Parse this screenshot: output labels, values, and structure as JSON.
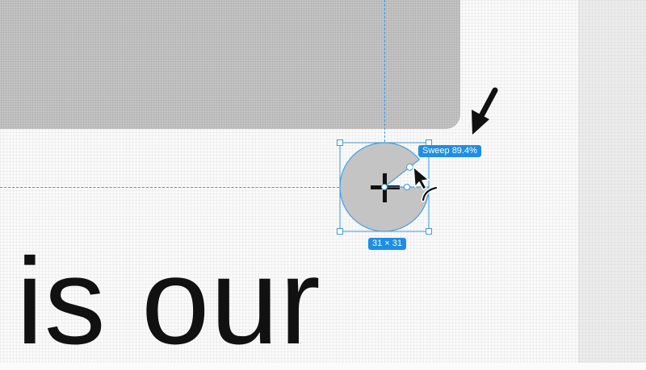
{
  "canvas": {
    "text": "is our"
  },
  "selection": {
    "sweep_label": "Sweep 89.4%",
    "sweep_percent": 89.4,
    "size_label": "31 × 31"
  },
  "colors": {
    "accent": "#1e8ee8",
    "shape_fill": "#c4c4c4",
    "text": "#111111"
  },
  "icons": {
    "pointer": "arrow-pointer-icon",
    "crosshair": "crosshair-icon",
    "sweep_cursor": "arc-cursor-icon"
  }
}
